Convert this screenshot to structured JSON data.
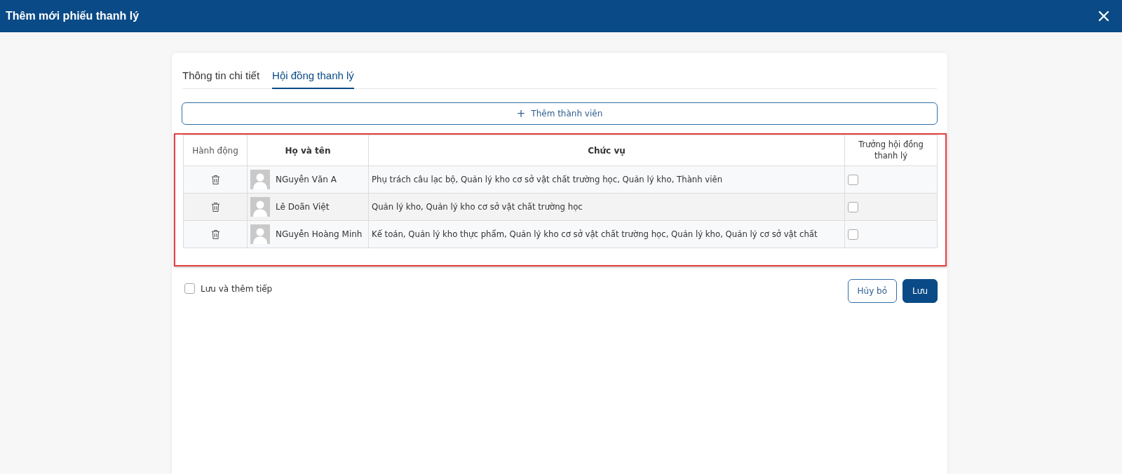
{
  "window": {
    "title": "Thêm mới phiếu thanh lý"
  },
  "tabs": [
    {
      "label": "Thông tin chi tiết",
      "selected": false
    },
    {
      "label": "Hội đồng thanh lý",
      "selected": true
    }
  ],
  "add_button": {
    "icon": "+",
    "label": "Thêm thành viên"
  },
  "table": {
    "columns": [
      "Hành động",
      "Họ và tên",
      "Chức vụ",
      "Trưởng hội đồng thanh lý"
    ],
    "rows": [
      {
        "name": "NGuyễn Văn A",
        "position": "Phụ trách câu lạc bộ, Quản lý kho cơ sở vật chất trường học, Quản lý kho, Thành viên",
        "head": false
      },
      {
        "name": "Lê Doãn Việt",
        "position": "Quản lý kho, Quản lý kho cơ sở vật chất trường học",
        "head": false
      },
      {
        "name": "NGuyễn Hoàng Minh",
        "position": "Kế toán, Quản lý kho thực phẩm, Quản lý kho cơ sở vật chất trường học, Quản lý kho, Quản lý cơ sở vật chất",
        "head": false
      }
    ]
  },
  "save_and_add": {
    "label": "Lưu và thêm tiếp",
    "checked": false
  },
  "buttons": [
    {
      "label": "Hủy bỏ",
      "kind": "secondary"
    },
    {
      "label": "Lưu",
      "kind": "primary"
    }
  ]
}
